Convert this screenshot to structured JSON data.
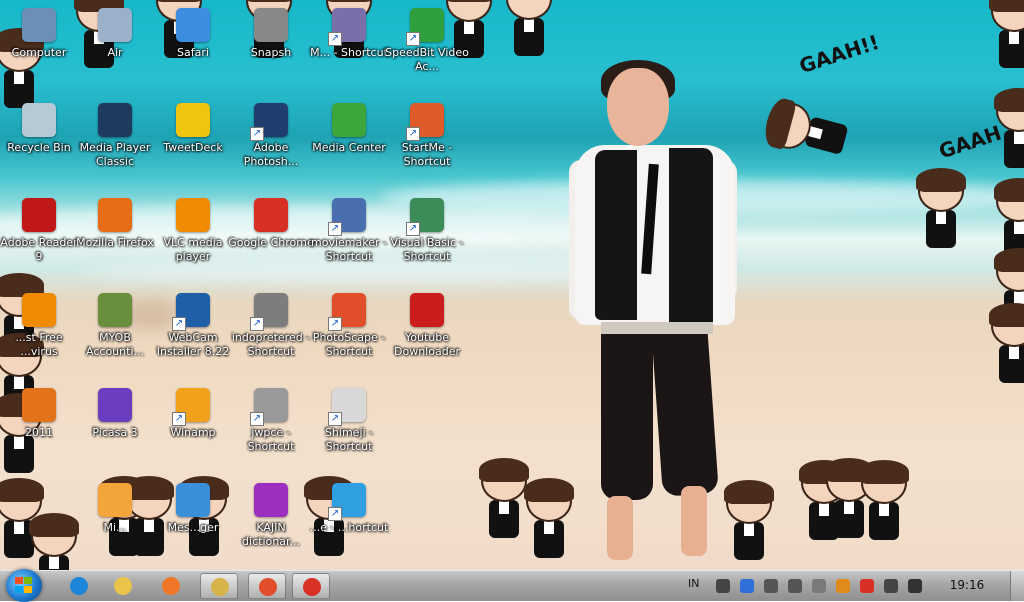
{
  "desktop": {
    "icons": [
      {
        "label": "Computer",
        "icon": "computer-icon",
        "color": "#6c8fb5",
        "shortcut": false
      },
      {
        "label": "Air",
        "icon": "air-icon",
        "color": "#9bb1c9",
        "shortcut": false
      },
      {
        "label": "Safari",
        "icon": "safari-icon",
        "color": "#3d8ee0",
        "shortcut": false
      },
      {
        "label": "Snapsh",
        "icon": "snapshot-icon",
        "color": "#888888",
        "shortcut": false
      },
      {
        "label": "M... - Shortcut",
        "icon": "app-icon",
        "color": "#7a6fa8",
        "shortcut": true
      },
      {
        "label": "SpeedBit Video Ac...",
        "icon": "speedbit-icon",
        "color": "#2f9f3e",
        "shortcut": true
      },
      {
        "label": "Recycle Bin",
        "icon": "recycle-bin-icon",
        "color": "#b8c9d6",
        "shortcut": false
      },
      {
        "label": "Media Player Classic",
        "icon": "media-player-classic-icon",
        "color": "#1e3a5f",
        "shortcut": false
      },
      {
        "label": "TweetDeck",
        "icon": "tweetdeck-icon",
        "color": "#f1c40f",
        "shortcut": false
      },
      {
        "label": "Adobe Photosh...",
        "icon": "photoshop-icon",
        "color": "#1f3e6e",
        "shortcut": true
      },
      {
        "label": "Media Center",
        "icon": "media-center-icon",
        "color": "#3da63a",
        "shortcut": false
      },
      {
        "label": "StartMe - Shortcut",
        "icon": "startme-icon",
        "color": "#e05a2a",
        "shortcut": true
      },
      {
        "label": "Adobe Reader 9",
        "icon": "adobe-reader-icon",
        "color": "#c01818",
        "shortcut": false
      },
      {
        "label": "Mozilla Firefox",
        "icon": "firefox-icon",
        "color": "#e66c16",
        "shortcut": false
      },
      {
        "label": "VLC media player",
        "icon": "vlc-icon",
        "color": "#f08a00",
        "shortcut": false
      },
      {
        "label": "Google Chrome",
        "icon": "chrome-icon",
        "color": "#d93025",
        "shortcut": false
      },
      {
        "label": "moviemaker - Shortcut",
        "icon": "moviemaker-icon",
        "color": "#4a6fb0",
        "shortcut": true
      },
      {
        "label": "Visual Basic - Shortcut",
        "icon": "visual-basic-icon",
        "color": "#3c8c5a",
        "shortcut": true
      },
      {
        "label": "...st Free ...virus",
        "icon": "avast-icon",
        "color": "#f08a00",
        "shortcut": false
      },
      {
        "label": "MYOB Accounti...",
        "icon": "myob-icon",
        "color": "#6a8f3c",
        "shortcut": false
      },
      {
        "label": "WebCam Installer 8.22",
        "icon": "webcam-icon",
        "color": "#1f5fa8",
        "shortcut": true
      },
      {
        "label": "indopretered - Shortcut",
        "icon": "indopretered-icon",
        "color": "#7d7d7d",
        "shortcut": true
      },
      {
        "label": "PhotoScape - Shortcut",
        "icon": "photoscape-icon",
        "color": "#e04f2a",
        "shortcut": true
      },
      {
        "label": "Youtube Downloader",
        "icon": "youtube-downloader-icon",
        "color": "#cc1d1d",
        "shortcut": false
      },
      {
        "label": "2011",
        "icon": "office-2011-icon",
        "color": "#e2731a",
        "shortcut": false
      },
      {
        "label": "Picasa 3",
        "icon": "picasa-icon",
        "color": "#6b3ec0",
        "shortcut": false
      },
      {
        "label": "Winamp",
        "icon": "winamp-icon",
        "color": "#f2a21a",
        "shortcut": true
      },
      {
        "label": "jwpce - Shortcut",
        "icon": "jwpce-icon",
        "color": "#9a9a9a",
        "shortcut": true
      },
      {
        "label": "Shimeji - Shortcut",
        "icon": "shimeji-icon",
        "color": "#d8d8d8",
        "shortcut": true
      },
      {
        "label": "Mi...",
        "icon": "app-icon",
        "color": "#f1a53a",
        "shortcut": false
      },
      {
        "label": "Mes...ger",
        "icon": "messenger-icon",
        "color": "#3a8fd8",
        "shortcut": false
      },
      {
        "label": "KAJIN dictionar...",
        "icon": "kajin-icon",
        "color": "#9c2fbf",
        "shortcut": false
      },
      {
        "label": "...e - ...hortcut",
        "icon": "app-icon",
        "color": "#2f9fe0",
        "shortcut": true
      }
    ]
  },
  "wallpaper": {
    "speech_1": "GAAH!!",
    "speech_2": "GAAH"
  },
  "taskbar": {
    "start_icon": "windows-start-icon",
    "pinned": [
      {
        "name": "internet-explorer",
        "icon": "internet-explorer-icon",
        "color": "#1e86d8",
        "active": false
      },
      {
        "name": "explorer-folder",
        "icon": "folder-icon",
        "color": "#e9c34a",
        "active": false
      },
      {
        "name": "media-player",
        "icon": "media-player-icon",
        "color": "#f0762a",
        "active": false
      },
      {
        "name": "windows-explorer",
        "icon": "windows-explorer-icon",
        "color": "#d6b44a",
        "active": true
      },
      {
        "name": "photoscape",
        "icon": "photoscape-icon",
        "color": "#e04f2a",
        "active": true
      },
      {
        "name": "chrome",
        "icon": "chrome-icon",
        "color": "#d93025",
        "active": true
      }
    ],
    "language": "IN",
    "tray_icons": [
      {
        "icon": "expand-tray-icon",
        "color": "#444444"
      },
      {
        "icon": "network-globe-icon",
        "color": "#2f6fd8"
      },
      {
        "icon": "volume-icon",
        "color": "#555555"
      },
      {
        "icon": "network-icon",
        "color": "#555555"
      },
      {
        "icon": "messenger-tray-icon",
        "color": "#7a7a7a"
      },
      {
        "icon": "avast-tray-icon",
        "color": "#e08a1a"
      },
      {
        "icon": "chrome-tray-icon",
        "color": "#d93025"
      },
      {
        "icon": "speaker-tray-icon",
        "color": "#444444"
      },
      {
        "icon": "action-center-flag-icon",
        "color": "#333333"
      }
    ],
    "clock": "19:16"
  }
}
